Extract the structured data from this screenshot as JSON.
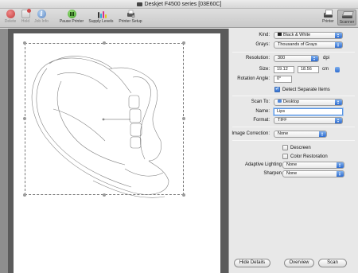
{
  "window": {
    "title": "Deskjet F4500 series [03E60C]"
  },
  "toolbar": {
    "delete_label": "Delete",
    "hold_label": "Hold",
    "job_info_label": "Job Info",
    "pause_printer_label": "Pause Printer",
    "supply_levels_label": "Supply Levels",
    "printer_setup_label": "Printer Setup",
    "printer_label": "Printer",
    "scanner_label": "Scanner"
  },
  "settings": {
    "kind": {
      "label": "Kind:",
      "value": "Black & White"
    },
    "grays": {
      "label": "Grays:",
      "value": "Thousands of Grays"
    },
    "resolution": {
      "label": "Resolution:",
      "value": "300",
      "unit": "dpi"
    },
    "size": {
      "label": "Size:",
      "width": "19.12",
      "height": "18.56",
      "unit": "cm"
    },
    "rotation": {
      "label": "Rotation Angle:",
      "value": "0°"
    },
    "detect_separate": {
      "label": "Detect Separate Items",
      "checked": true
    },
    "scan_to": {
      "label": "Scan To:",
      "value": "Desktop"
    },
    "name": {
      "label": "Name:",
      "value": "Lips"
    },
    "format": {
      "label": "Format:",
      "value": "TIFF"
    },
    "image_correction": {
      "label": "Image Correction:",
      "value": "None"
    },
    "descreen": {
      "label": "Descreen",
      "checked": false
    },
    "color_restoration": {
      "label": "Color Restoration",
      "checked": false
    },
    "adaptive_lighting": {
      "label": "Adaptive Lighting",
      "value": "None"
    },
    "sharpen": {
      "label": "Sharpen",
      "value": "None"
    }
  },
  "buttons": {
    "hide_details": "Hide Details",
    "overview": "Overview",
    "scan": "Scan"
  },
  "icons": {
    "delete": "delete-icon",
    "hold": "hold-icon",
    "job_info": "info-icon",
    "pause": "pause-icon",
    "supply": "ink-levels-icon",
    "setup": "printer-setup-icon",
    "printer": "printer-icon",
    "scanner": "scanner-icon"
  }
}
